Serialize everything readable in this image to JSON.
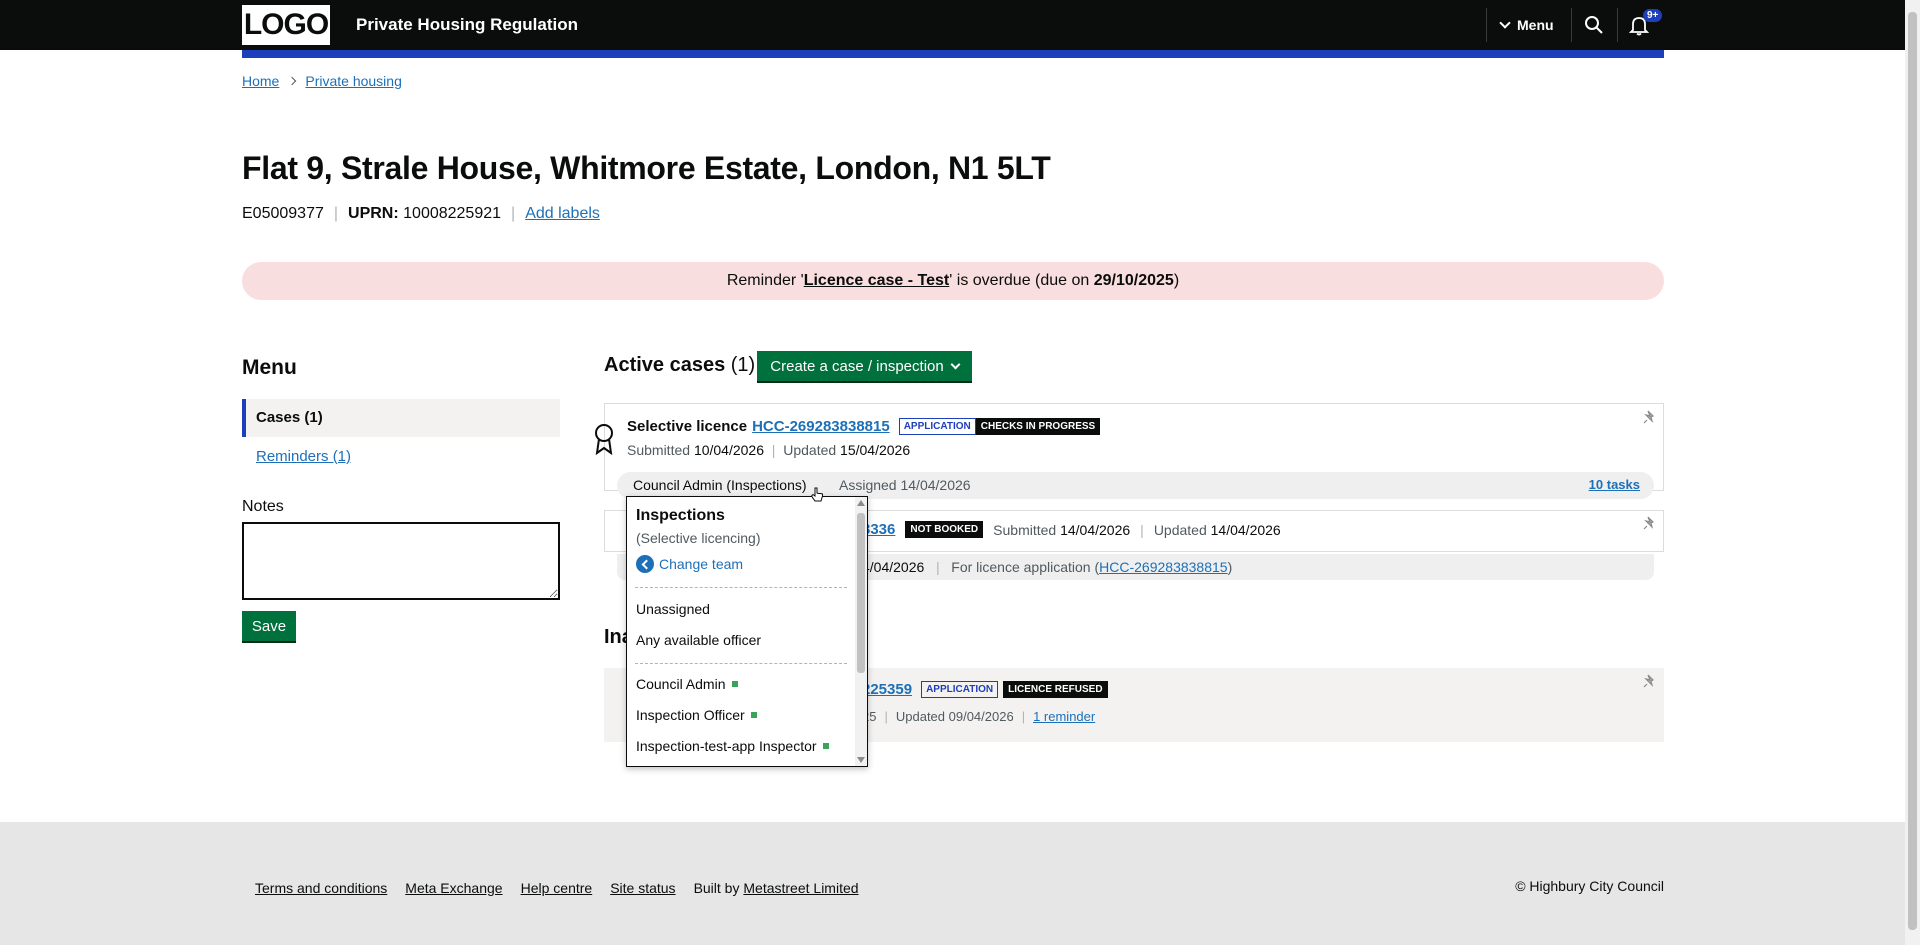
{
  "header": {
    "logo": "LOGO",
    "app_title": "Private Housing Regulation",
    "menu_label": "Menu",
    "notification_badge": "9+"
  },
  "breadcrumb": {
    "home": "Home",
    "current": "Private housing"
  },
  "property": {
    "title": "Flat 9, Strale House, Whitmore Estate, London, N1 5LT",
    "ward_code": "E05009377",
    "uprn_label": "UPRN:",
    "uprn_value": "10008225921",
    "add_labels": "Add labels"
  },
  "reminder_banner": {
    "prefix": "Reminder '",
    "link": "Licence case - Test",
    "middle": "' is overdue (due on ",
    "date": "29/10/2025",
    "suffix": ")"
  },
  "sidebar": {
    "title": "Menu",
    "items": [
      {
        "label": "Cases (1)",
        "active": true
      },
      {
        "label": "Reminders (1)",
        "active": false
      }
    ],
    "notes_label": "Notes",
    "save_label": "Save"
  },
  "active_cases": {
    "heading": "Active cases",
    "count": "(1)",
    "create_button": "Create a case / inspection",
    "case": {
      "type": "Selective licence",
      "reference": "HCC-269283838815",
      "tag_stage": "APPLICATION",
      "tag_status": "CHECKS IN PROGRESS",
      "submitted_label": "Submitted",
      "submitted_date": "10/04/2026",
      "updated_label": "Updated",
      "updated_date": "15/04/2026",
      "assignee": "Council Admin (Inspections)",
      "assigned_text": "Assigned 14/04/2026",
      "tasks_link": "10 tasks"
    },
    "inspection": {
      "reference_partial": "3336",
      "tag_status": "NOT BOOKED",
      "submitted_label": "Submitted",
      "submitted_date": "14/04/2026",
      "updated_label": "Updated",
      "updated_date": "14/04/2026",
      "date_partial": "4/04/2026",
      "for_licence_prefix": "For licence application (",
      "for_licence_link": "HCC-269283838815",
      "for_licence_suffix": ")"
    }
  },
  "inactive_cases": {
    "heading_partial": "Ina",
    "reference_partial": "225359",
    "tag_stage": "APPLICATION",
    "tag_status": "LICENCE REFUSED",
    "date_partial": "25",
    "updated_text": "Updated 09/04/2026",
    "reminder_link": "1 reminder"
  },
  "assign_dropdown": {
    "team_title": "Inspections",
    "team_subtitle": "(Selective licencing)",
    "change_team": "Change team",
    "options_general": [
      "Unassigned",
      "Any available officer"
    ],
    "options_officers": [
      "Council Admin",
      "Inspection Officer",
      "Inspection-test-app Inspector"
    ]
  },
  "footer": {
    "links": [
      "Terms and conditions",
      "Meta Exchange",
      "Help centre",
      "Site status"
    ],
    "built_by_prefix": "Built by",
    "built_by_link": "Metastreet Limited",
    "copyright": "© Highbury City Council"
  }
}
